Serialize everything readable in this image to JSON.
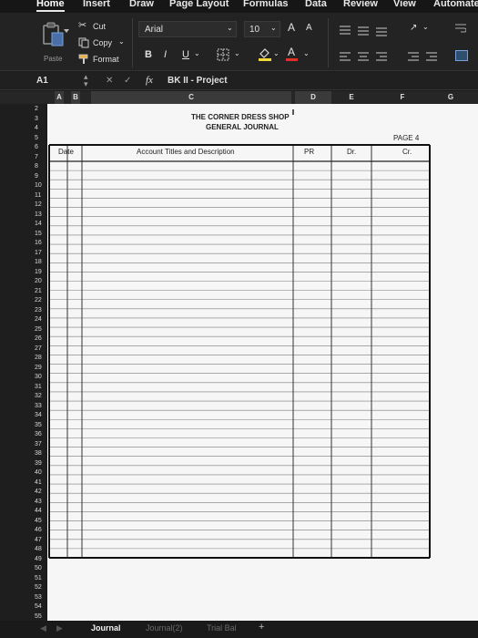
{
  "ribbon_tabs": [
    "Home",
    "Insert",
    "Draw",
    "Page Layout",
    "Formulas",
    "Data",
    "Review",
    "View",
    "Automate"
  ],
  "clipboard": {
    "paste": "Paste",
    "cut": "Cut",
    "copy": "Copy",
    "format": "Format"
  },
  "font": {
    "name": "Arial",
    "size": "10",
    "grow": "A",
    "shrink": "A",
    "bold": "B",
    "italic": "I",
    "underline": "U",
    "font_color_letter": "A"
  },
  "formula_bar": {
    "cell_ref": "A1",
    "fx": "fx",
    "content": "BK II - Project"
  },
  "columns": [
    "A",
    "B",
    "C",
    "D",
    "E",
    "F",
    "G"
  ],
  "rows": [
    "2",
    "3",
    "4",
    "5",
    "6",
    "7",
    "8",
    "9",
    "10",
    "11",
    "12",
    "13",
    "14",
    "15",
    "16",
    "17",
    "18",
    "19",
    "20",
    "21",
    "22",
    "23",
    "24",
    "25",
    "26",
    "27",
    "28",
    "29",
    "30",
    "31",
    "32",
    "33",
    "34",
    "35",
    "36",
    "37",
    "38",
    "39",
    "40",
    "41",
    "42",
    "43",
    "44",
    "45",
    "46",
    "47",
    "48",
    "49",
    "50",
    "51",
    "52",
    "53",
    "54",
    "55"
  ],
  "journal": {
    "company": "THE CORNER DRESS SHOP",
    "title": "GENERAL JOURNAL",
    "page": "PAGE 4",
    "headers": {
      "date": "Date",
      "account": "Account Titles and Description",
      "pr": "PR",
      "dr": "Dr.",
      "cr": "Cr."
    }
  },
  "sheet_tabs": [
    "Journal",
    "Journal(2)",
    "Trial Bal"
  ],
  "add_sheet": "+"
}
